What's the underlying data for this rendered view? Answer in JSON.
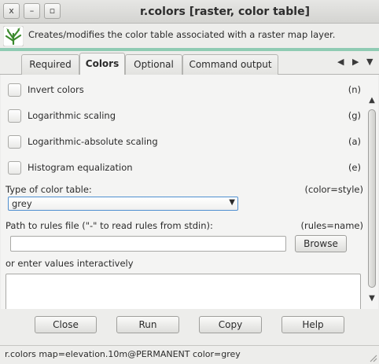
{
  "window": {
    "title": "r.colors [raster, color table]",
    "close_glyph": "x",
    "minimize_glyph": "–",
    "maximize_glyph": "▫"
  },
  "description": {
    "icon": "grass-logo-icon",
    "text": "Creates/modifies the color table associated with a raster map layer."
  },
  "tabs": [
    {
      "label": "Required",
      "active": false
    },
    {
      "label": "Colors",
      "active": true
    },
    {
      "label": "Optional",
      "active": false
    },
    {
      "label": "Command output",
      "active": false
    }
  ],
  "tab_scroll": {
    "left": "◀",
    "right": "▶",
    "menu": "▼"
  },
  "options": [
    {
      "label": "Invert colors",
      "flag": "(n)",
      "checked": false
    },
    {
      "label": "Logarithmic scaling",
      "flag": "(g)",
      "checked": false
    },
    {
      "label": "Logarithmic-absolute scaling",
      "flag": "(a)",
      "checked": false
    },
    {
      "label": "Histogram equalization",
      "flag": "(e)",
      "checked": false
    }
  ],
  "color_table": {
    "label": "Type of color table:",
    "param": "(color=style)",
    "value": "grey"
  },
  "rules_file": {
    "label": "Path to rules file (\"-\" to read rules from stdin):",
    "param": "(rules=name)",
    "value": "",
    "browse_label": "Browse"
  },
  "interactive": {
    "label": "or enter values interactively",
    "value": ""
  },
  "buttons": {
    "close": "Close",
    "run": "Run",
    "copy": "Copy",
    "help": "Help"
  },
  "status": {
    "command": "r.colors map=elevation.10m@PERMANENT color=grey"
  }
}
